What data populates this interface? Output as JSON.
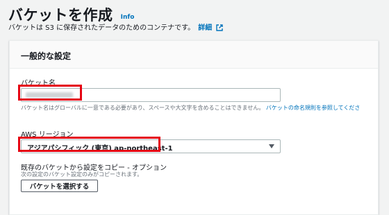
{
  "header": {
    "title": "バケットを作成",
    "info_link": "Info",
    "description": "バケットは S3 に保存されたデータのためのコンテナです。",
    "details_link": "詳細"
  },
  "panel": {
    "title": "一般的な設定",
    "bucket_name": {
      "label": "バケット名",
      "value": "",
      "hint": "バケット名はグローバルに一意である必要があり、スペースや大文字を含めることはできません。",
      "hint_link": "バケットの命名規則を参照してくださ"
    },
    "region": {
      "label": "AWS リージョン",
      "selected": "アジアパシフィック (東京) ap-northeast-1"
    },
    "copy_settings": {
      "label": "既存のバケットから設定をコピー - オプション",
      "sub": "次の設定のバケット設定のみがコピーされます。",
      "button": "バケットを選択する"
    }
  },
  "colors": {
    "link": "#0073bb",
    "highlight": "#e50012",
    "background": "#f2f3f3"
  }
}
